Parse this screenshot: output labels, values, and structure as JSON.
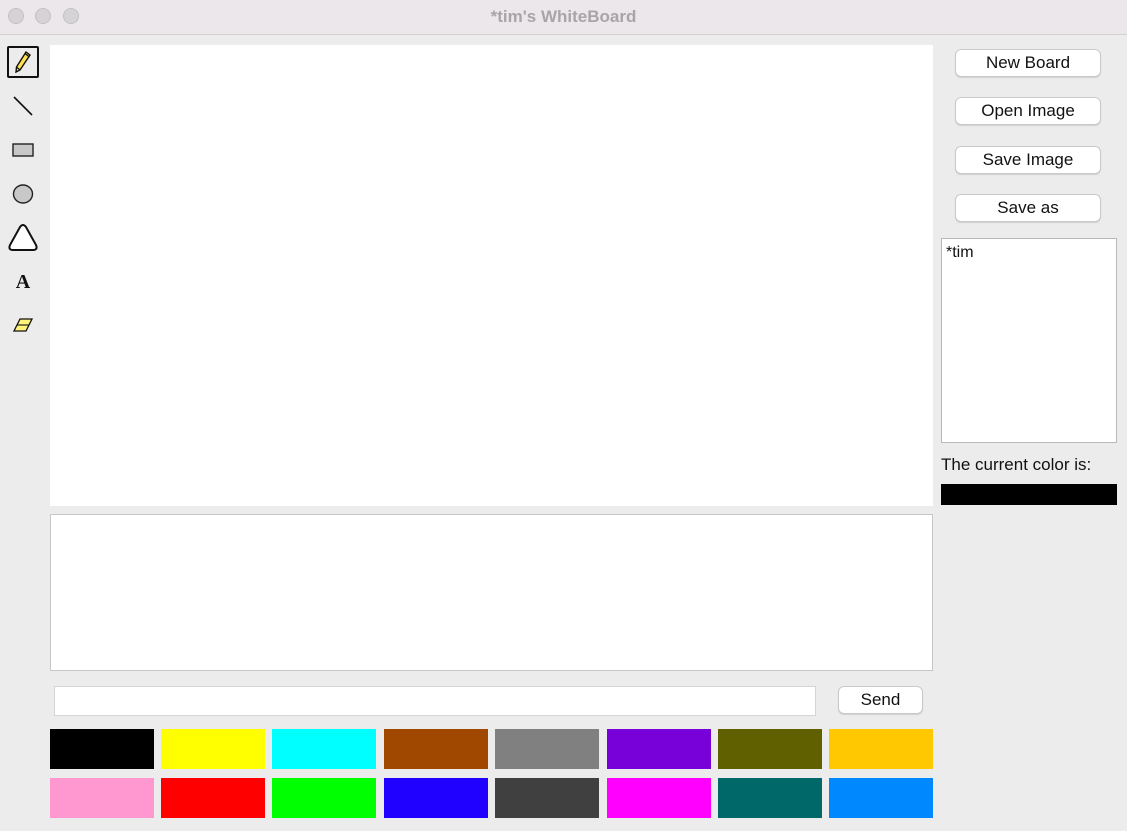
{
  "window": {
    "title": "*tim's WhiteBoard"
  },
  "tools": [
    {
      "name": "pencil-tool",
      "icon": "pencil-icon",
      "selected": true
    },
    {
      "name": "line-tool",
      "icon": "line-icon",
      "selected": false
    },
    {
      "name": "rectangle-tool",
      "icon": "rectangle-icon",
      "selected": false
    },
    {
      "name": "oval-tool",
      "icon": "oval-icon",
      "selected": false
    },
    {
      "name": "triangle-tool",
      "icon": "triangle-icon",
      "selected": false
    },
    {
      "name": "text-tool",
      "icon": "text-icon",
      "label": "A",
      "selected": false
    },
    {
      "name": "eraser-tool",
      "icon": "eraser-icon",
      "selected": false
    }
  ],
  "sidebar": {
    "buttons": [
      "New Board",
      "Open Image",
      "Save Image",
      "Save as"
    ],
    "users": [
      "*tim"
    ],
    "current_color_label": "The current color is:",
    "current_color": "#000000"
  },
  "chat": {
    "input_value": "",
    "send_label": "Send"
  },
  "palette": [
    [
      "#000000",
      "#ffff00",
      "#00ffff",
      "#a04800",
      "#808080",
      "#7800d8",
      "#606000",
      "#ffc800"
    ],
    [
      "#ff98d0",
      "#ff0000",
      "#00ff00",
      "#2000ff",
      "#404040",
      "#ff00ff",
      "#006868",
      "#0088ff"
    ]
  ]
}
